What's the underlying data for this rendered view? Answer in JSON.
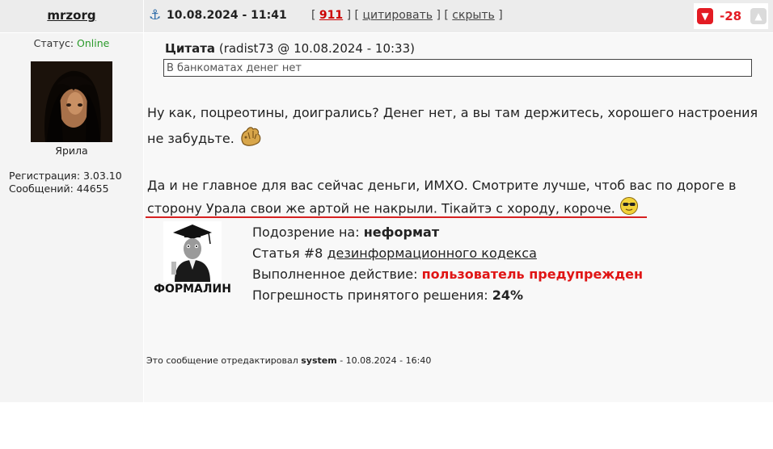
{
  "post": {
    "author": "mrzorg",
    "date": "10.08.2024 - 11:41",
    "links": {
      "number": "911",
      "quote": "цитировать",
      "hide": "скрыть"
    },
    "score": "-28"
  },
  "sidebar": {
    "status_label": "Статус:",
    "status_value": "Online",
    "avatar_name": "Ярила",
    "registration": "Регистрация: 3.03.10",
    "messages": "Сообщений: 44655"
  },
  "quote": {
    "title": "Цитата",
    "meta": "(radist73 @ 10.08.2024 - 10:33)",
    "text": "В банкоматах денег нет"
  },
  "message": {
    "p1": "Ну как, поцреотины, доигрались? Денег нет, а вы там держитесь, хорошего настроения не забудьте.",
    "p2": "Да и не главное для вас сейчас деньги, ИМХО. Смотрите лучше, чтоб вас по дороге в сторону Урала свои же артой не накрыли. Тікайтэ с хороду, короче."
  },
  "moderation": {
    "bot_name": "ФОРМАЛИН",
    "suspicion_label": "Подозрение на:",
    "suspicion_value": "неформат",
    "article_prefix": "Статья #8",
    "article_link": "дезинформационного кодекса",
    "action_label": "Выполненное действие:",
    "action_value": "пользователь предупрежден",
    "error_label": "Погрешность принятого решения:",
    "error_value": "24%"
  },
  "edited": {
    "prefix": "Это сообщение отредактировал",
    "user": "system",
    "suffix": "- 10.08.2024 - 16:40"
  },
  "icons": {
    "anchor": "anchor-icon",
    "thumb_down": "thumb-down-icon",
    "thumb_up": "thumb-up-icon",
    "clap": "clap-smiley-icon",
    "cool": "sunglasses-smiley-icon"
  },
  "colors": {
    "score": "#e31b23",
    "online": "#2a9a2a",
    "action": "#e01515",
    "underline": "#d62020"
  }
}
